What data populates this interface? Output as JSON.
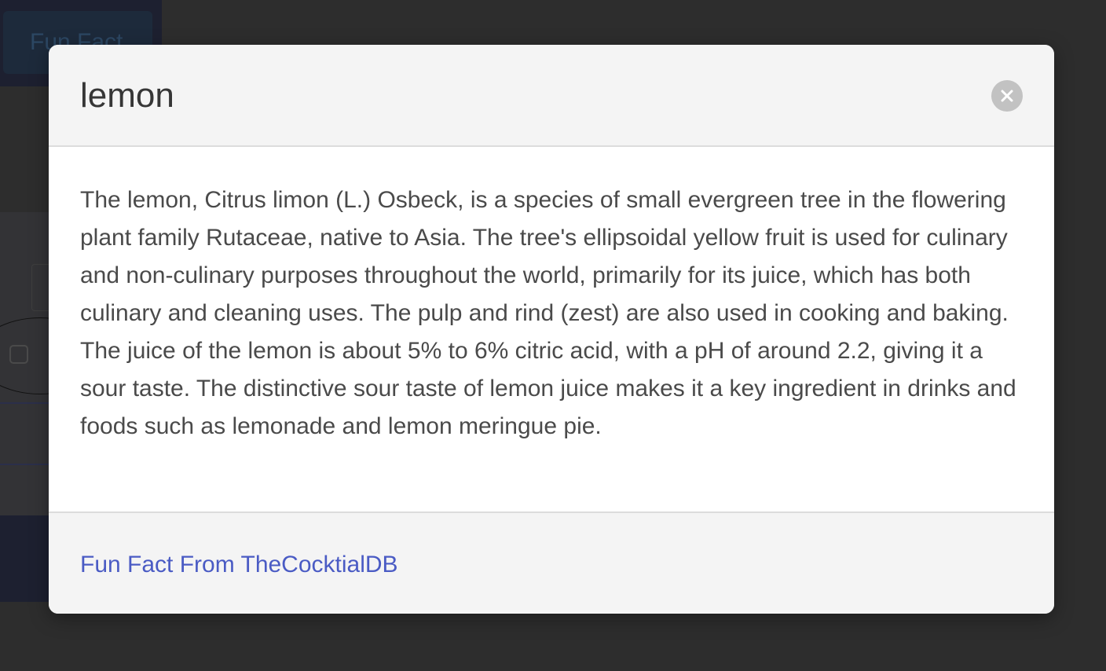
{
  "background": {
    "header_button_label": "Fun Fact"
  },
  "modal": {
    "title": "lemon",
    "close_label": "×",
    "body_text": "The lemon, Citrus limon (L.) Osbeck, is a species of small evergreen tree in the flowering plant family Rutaceae, native to Asia. The tree's ellipsoidal yellow fruit is used for culinary and non-culinary purposes throughout the world, primarily for its juice, which has both culinary and cleaning uses. The pulp and rind (zest) are also used in cooking and baking. The juice of the lemon is about 5% to 6% citric acid, with a pH of around 2.2, giving it a sour taste. The distinctive sour taste of lemon juice makes it a key ingredient in drinks and foods such as lemonade and lemon meringue pie.",
    "footer_link": "Fun Fact From TheCocktialDB"
  },
  "colors": {
    "overlay": "#2e2e2e",
    "link": "#4a5bc4",
    "close_button": "#c2c2c2"
  },
  "icons": {
    "close": "close-icon"
  }
}
